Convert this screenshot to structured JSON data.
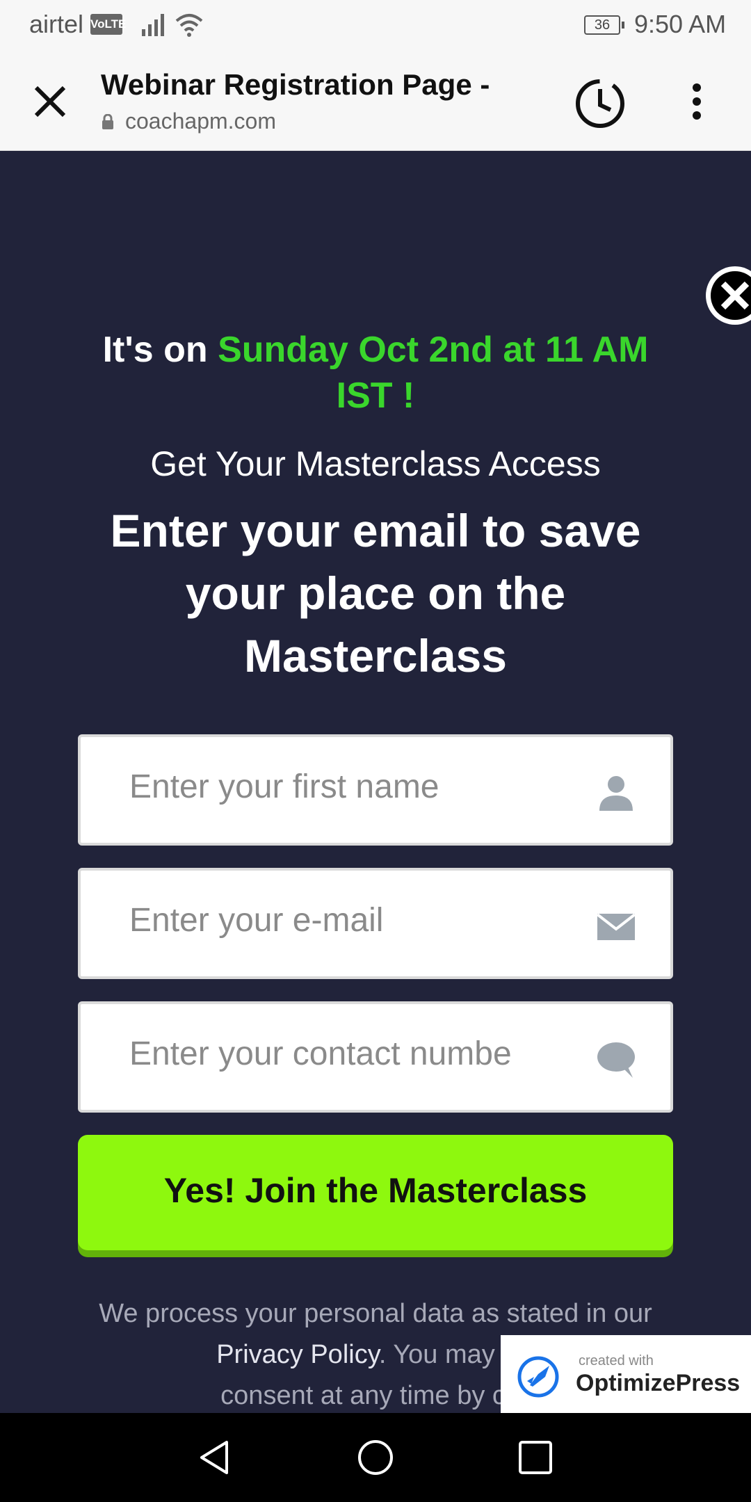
{
  "status_bar": {
    "carrier": "airtel",
    "volte": "VoLTE",
    "battery": "36",
    "time": "9:50 AM"
  },
  "browser": {
    "page_title": "Webinar Registration Page -",
    "url": "coachapm.com"
  },
  "hero": {
    "prefix": "It's on ",
    "highlight": "Sunday Oct 2nd at 11 AM IST !",
    "subtitle": "Get Your Masterclass Access",
    "heading": "Enter your email to save your place on the Masterclass"
  },
  "form": {
    "first_name_placeholder": "Enter your first name",
    "email_placeholder": "Enter your e-mail",
    "contact_placeholder": "Enter your contact numbe",
    "submit_label": "Yes! Join the Masterclass"
  },
  "privacy": {
    "text_1": "We process your personal data as stated in our ",
    "link": "Privacy Policy",
    "text_2": ". You may wit",
    "text_3": "consent at any time by clic"
  },
  "badge": {
    "created_with": "created with",
    "name": "OptimizePress"
  },
  "colors": {
    "background": "#21233a",
    "accent_green": "#3ad62c",
    "button_green": "#8ef80e"
  }
}
